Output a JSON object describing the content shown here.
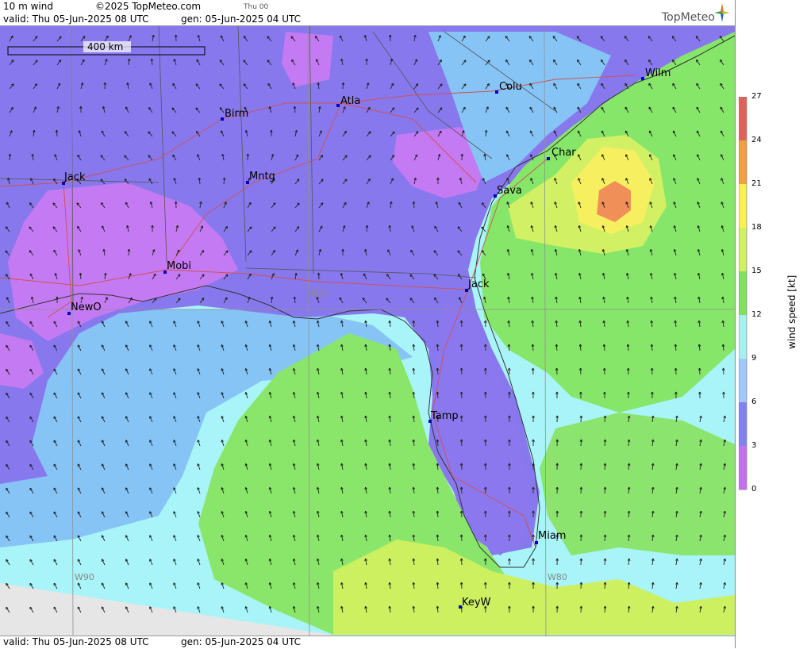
{
  "header": {
    "product": "10 m wind",
    "copyright": "©2025 TopMeteo.com",
    "thu": "Thu 00",
    "valid": "valid:  Thu  05-Jun-2025  08 UTC",
    "gen": "gen: 05-Jun-2025 04 UTC",
    "logo": "TopMeteo"
  },
  "footer": {
    "valid": "valid:  Thu  05-Jun-2025  08 UTC",
    "gen": "gen: 05-Jun-2025 04 UTC"
  },
  "scale": {
    "label": "400 km"
  },
  "grid_labels": [
    "N30",
    "W90",
    "W80"
  ],
  "cities": [
    {
      "name": "Birm"
    },
    {
      "name": "Atla"
    },
    {
      "name": "Colu"
    },
    {
      "name": "Wilm"
    },
    {
      "name": "Jack"
    },
    {
      "name": "Mntg"
    },
    {
      "name": "Char"
    },
    {
      "name": "Sava"
    },
    {
      "name": "Mobi"
    },
    {
      "name": "Jack"
    },
    {
      "name": "NewO"
    },
    {
      "name": "Tamp"
    },
    {
      "name": "Miam"
    },
    {
      "name": "KeyW"
    }
  ],
  "legend": {
    "title": "wind speed [kt]",
    "ticks": [
      "27",
      "24",
      "21",
      "18",
      "15",
      "12",
      "9",
      "6",
      "3",
      "0"
    ],
    "colors": [
      "#e0605a",
      "#f0a040",
      "#f8f050",
      "#d0f060",
      "#80e060",
      "#50d880",
      "#a0f0f0",
      "#a0c8f8",
      "#8080f0",
      "#c070f0"
    ]
  },
  "colors": {
    "calm": "#c080f0",
    "light": "#8c78f0",
    "moderate_low": "#80c0f8",
    "moderate": "#a8f0f8",
    "fresh": "#90e868",
    "strong": "#d0f060",
    "very_strong": "#f8f060",
    "max": "#f09050"
  }
}
